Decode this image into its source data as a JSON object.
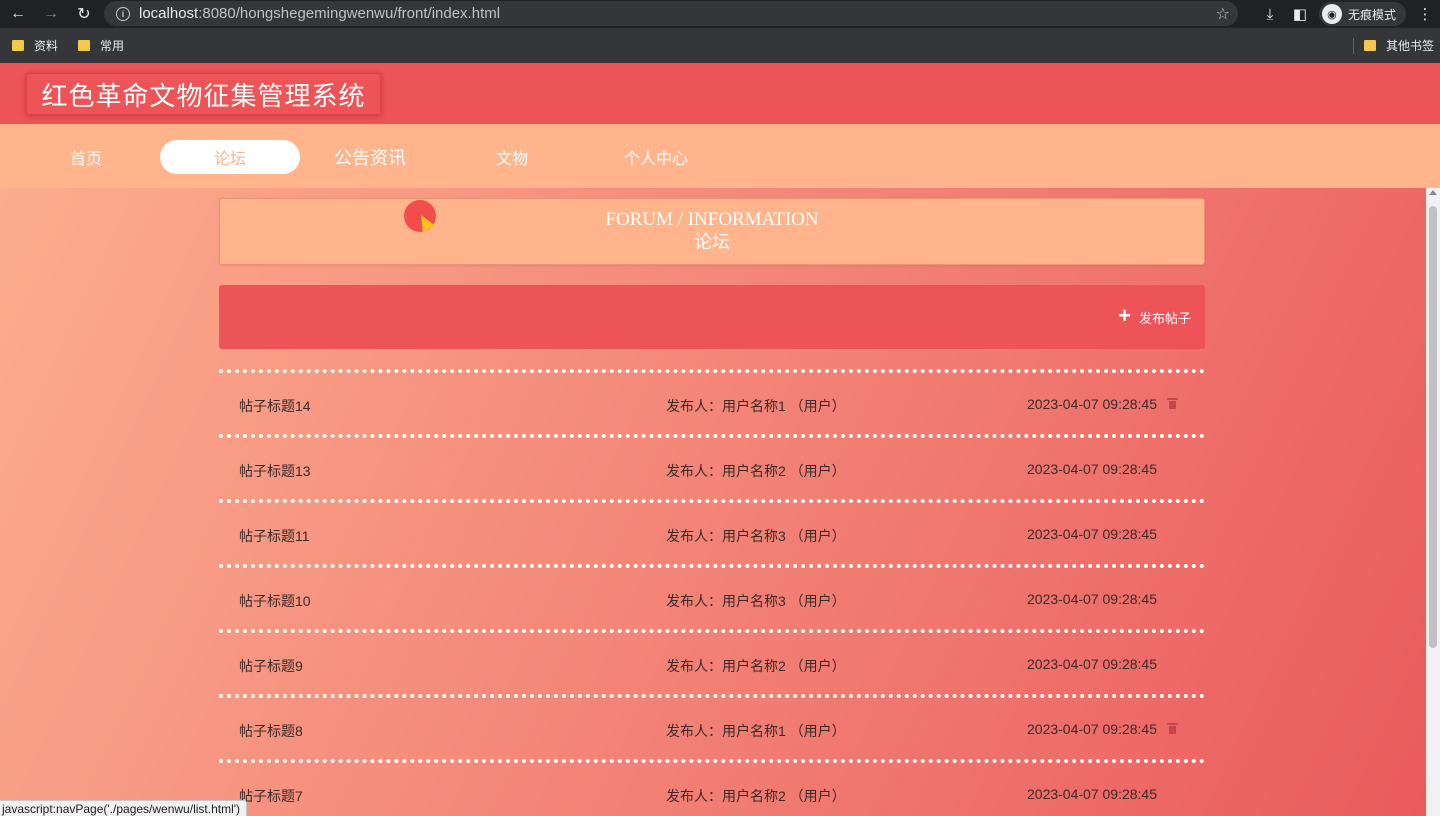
{
  "browser": {
    "url_host": "localhost",
    "url_rest": ":8080/hongshegemingwenwu/front/index.html",
    "incognito_label": "无痕模式",
    "bookmarks": [
      "资料",
      "常用"
    ],
    "other_bookmarks": "其他书签"
  },
  "header": {
    "logo_title": "红色革命文物征集管理系统"
  },
  "nav": {
    "items": [
      {
        "label": "首页"
      },
      {
        "label": "论坛",
        "active": true
      },
      {
        "label": "公告资讯"
      },
      {
        "label": "文物"
      },
      {
        "label": "个人中心"
      }
    ]
  },
  "section": {
    "title_en": "FORUM / INFORMATION",
    "title_cn": "论坛"
  },
  "actions": {
    "post_label": "发布帖子",
    "post_icon": "plus-icon"
  },
  "posts": [
    {
      "title": "帖子标题14",
      "author": "发布人：用户名称1 （用户）",
      "date": "2023-04-07 09:28:45",
      "deletable": true
    },
    {
      "title": "帖子标题13",
      "author": "发布人：用户名称2 （用户）",
      "date": "2023-04-07 09:28:45",
      "deletable": false
    },
    {
      "title": "帖子标题11",
      "author": "发布人：用户名称3 （用户）",
      "date": "2023-04-07 09:28:45",
      "deletable": false
    },
    {
      "title": "帖子标题10",
      "author": "发布人：用户名称3 （用户）",
      "date": "2023-04-07 09:28:45",
      "deletable": false
    },
    {
      "title": "帖子标题9",
      "author": "发布人：用户名称2 （用户）",
      "date": "2023-04-07 09:28:45",
      "deletable": false
    },
    {
      "title": "帖子标题8",
      "author": "发布人：用户名称1 （用户）",
      "date": "2023-04-07 09:28:45",
      "deletable": true
    },
    {
      "title": "帖子标题7",
      "author": "发布人：用户名称2 （用户）",
      "date": "2023-04-07 09:28:45",
      "deletable": false
    }
  ],
  "status_text": "javascript:navPage('./pages/wenwu/list.html')",
  "colors": {
    "header_red": "#ec5458",
    "nav_peach": "#ffb48c",
    "gradient_start": "#fcb090",
    "gradient_end": "#ea5a5c"
  }
}
